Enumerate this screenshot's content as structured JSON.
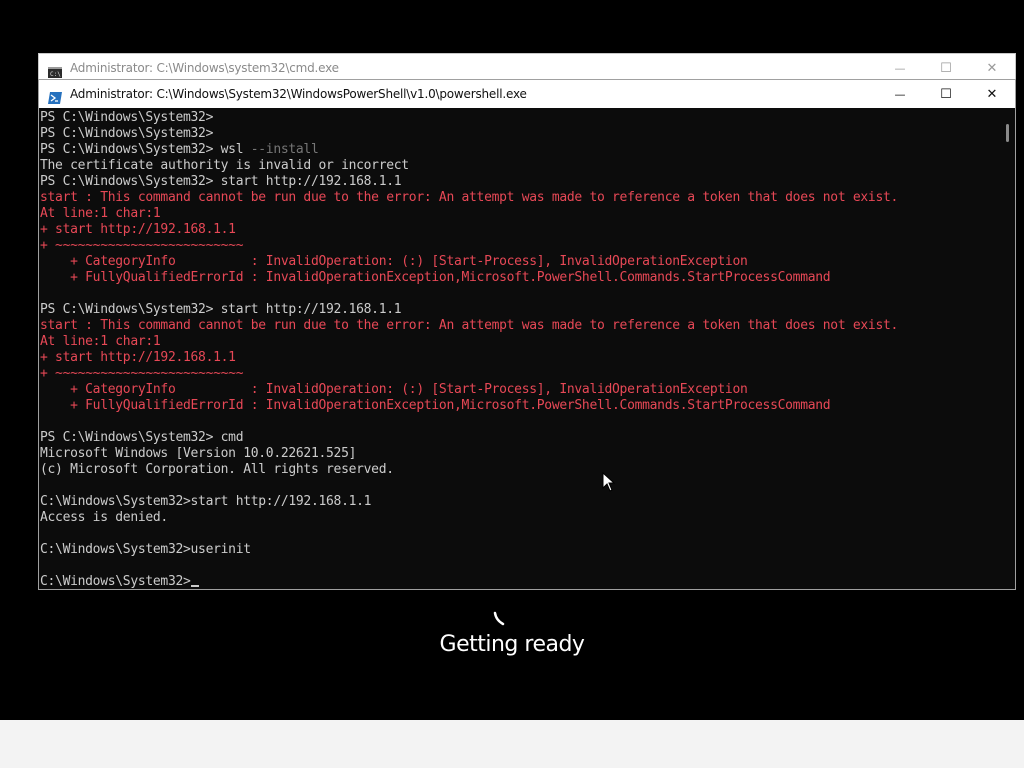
{
  "cmd_window": {
    "title": "Administrator: C:\\Windows\\system32\\cmd.exe",
    "icon": "cmd-icon",
    "minimize": "—",
    "maximize": "☐",
    "close": "✕"
  },
  "ps_window": {
    "title": "Administrator: C:\\Windows\\System32\\WindowsPowerShell\\v1.0\\powershell.exe",
    "icon": "powershell-icon",
    "minimize": "—",
    "maximize": "☐",
    "close": "✕"
  },
  "console_lines": [
    {
      "text": "PS C:\\Windows\\System32>",
      "style": "normal"
    },
    {
      "text": "PS C:\\Windows\\System32>",
      "style": "normal"
    },
    {
      "text": "PS C:\\Windows\\System32> wsl ",
      "muted": "--install",
      "style": "normal"
    },
    {
      "text": "The certificate authority is invalid or incorrect",
      "style": "normal"
    },
    {
      "text": "PS C:\\Windows\\System32> start http://192.168.1.1",
      "style": "normal"
    },
    {
      "text": "start : This command cannot be run due to the error: An attempt was made to reference a token that does not exist.",
      "style": "err"
    },
    {
      "text": "At line:1 char:1",
      "style": "err"
    },
    {
      "text": "+ start http://192.168.1.1",
      "style": "err"
    },
    {
      "text": "+ ~~~~~~~~~~~~~~~~~~~~~~~~~",
      "style": "err"
    },
    {
      "text": "    + CategoryInfo          : InvalidOperation: (:) [Start-Process], InvalidOperationException",
      "style": "err"
    },
    {
      "text": "    + FullyQualifiedErrorId : InvalidOperationException,Microsoft.PowerShell.Commands.StartProcessCommand",
      "style": "err"
    },
    {
      "text": "",
      "style": "normal"
    },
    {
      "text": "PS C:\\Windows\\System32> start http://192.168.1.1",
      "style": "normal"
    },
    {
      "text": "start : This command cannot be run due to the error: An attempt was made to reference a token that does not exist.",
      "style": "err"
    },
    {
      "text": "At line:1 char:1",
      "style": "err"
    },
    {
      "text": "+ start http://192.168.1.1",
      "style": "err"
    },
    {
      "text": "+ ~~~~~~~~~~~~~~~~~~~~~~~~~",
      "style": "err"
    },
    {
      "text": "    + CategoryInfo          : InvalidOperation: (:) [Start-Process], InvalidOperationException",
      "style": "err"
    },
    {
      "text": "    + FullyQualifiedErrorId : InvalidOperationException,Microsoft.PowerShell.Commands.StartProcessCommand",
      "style": "err"
    },
    {
      "text": "",
      "style": "normal"
    },
    {
      "text": "PS C:\\Windows\\System32> cmd",
      "style": "normal"
    },
    {
      "text": "Microsoft Windows [Version 10.0.22621.525]",
      "style": "normal"
    },
    {
      "text": "(c) Microsoft Corporation. All rights reserved.",
      "style": "normal"
    },
    {
      "text": "",
      "style": "normal"
    },
    {
      "text": "C:\\Windows\\System32>start http://192.168.1.1",
      "style": "normal"
    },
    {
      "text": "Access is denied.",
      "style": "normal"
    },
    {
      "text": "",
      "style": "normal"
    },
    {
      "text": "C:\\Windows\\System32>userinit",
      "style": "normal"
    },
    {
      "text": "",
      "style": "normal"
    },
    {
      "text": "C:\\Windows\\System32>",
      "style": "normal",
      "cursor": true
    }
  ],
  "status": {
    "text": "Getting ready",
    "spinner_icon": "loading-spinner-icon"
  },
  "colors": {
    "console_bg": "#0c0c0c",
    "console_text": "#cccccc",
    "error_text": "#e74856",
    "screen_bg": "#000000"
  }
}
